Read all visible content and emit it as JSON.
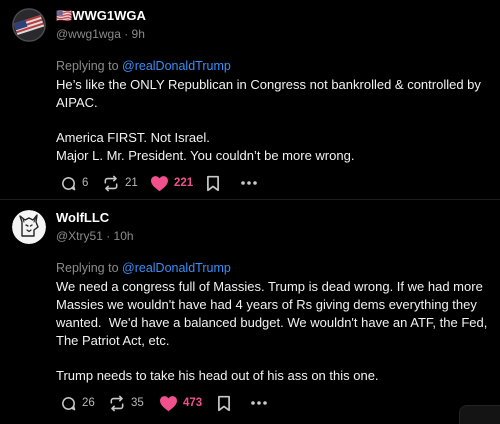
{
  "posts": [
    {
      "username": "🇺🇸WWG1WGA",
      "handle": "@wwg1wga",
      "time": "9h",
      "reply_prefix": "Replying to ",
      "reply_mention": "@realDonaldTrump",
      "paragraphs": [
        "He’s like the ONLY Republican in Congress not bankrolled & controlled by AIPAC.",
        "America FIRST. Not Israel.\nMajor L. Mr. President. You couldn’t be more wrong."
      ],
      "comments": "6",
      "reposts": "21",
      "likes": "221",
      "avatar_icon": "flag-avatar-icon"
    },
    {
      "username": "WolfLLC",
      "handle": "@Xtry51",
      "time": "10h",
      "reply_prefix": "Replying to ",
      "reply_mention": "@realDonaldTrump",
      "paragraphs": [
        "We need a congress full of Massies. Trump is dead wrong. If we had more Massies we wouldn't have had 4 years of Rs giving dems everything they wanted.  We'd have a balanced budget. We wouldn't have an ATF, the Fed, The Patriot Act, etc.",
        "Trump needs to take his head out of his ass on this one."
      ],
      "comments": "26",
      "reposts": "35",
      "likes": "473",
      "avatar_icon": "wolf-avatar-icon"
    }
  ],
  "separator": " · ",
  "icons": {
    "comment": "comment-icon",
    "repost": "repost-icon",
    "like": "heart-icon",
    "bookmark": "bookmark-icon",
    "more": "more-icon"
  },
  "colors": {
    "background": "#000000",
    "mention": "#3a8ef6",
    "muted": "#8b8b8b",
    "like": "#f0508c"
  }
}
